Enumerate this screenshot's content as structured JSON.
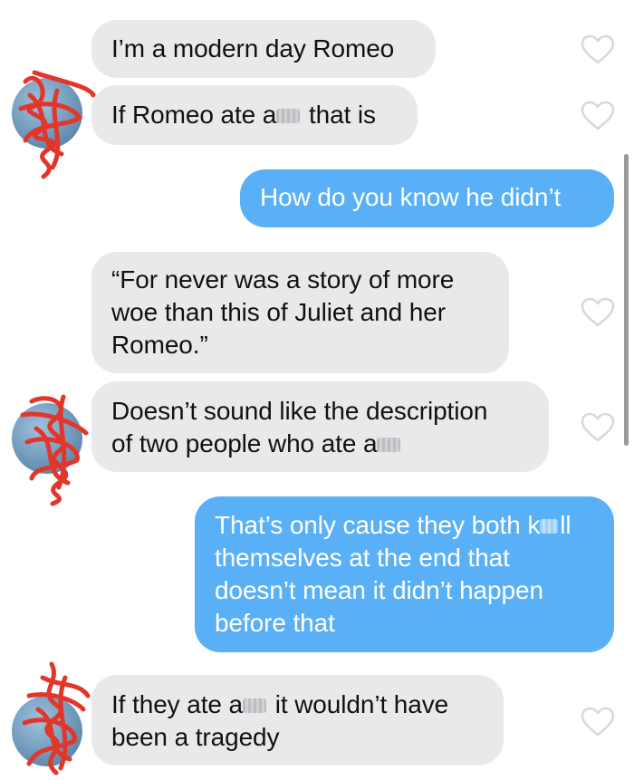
{
  "conversation": {
    "messages": [
      {
        "sender": "them",
        "text_lines": [
          "I’m a modern day Romeo"
        ]
      },
      {
        "sender": "them",
        "text_before": "If Romeo ate a",
        "text_after": " that is"
      },
      {
        "sender": "me",
        "text_lines": [
          "How do you know he didn’t"
        ]
      },
      {
        "sender": "them",
        "text_lines": [
          "“For never was a story of more",
          "woe than this of Juliet and her",
          "Romeo.”"
        ]
      },
      {
        "sender": "them",
        "line1": "Doesn’t sound like the description",
        "line2_before": "of two people who ate a"
      },
      {
        "sender": "me",
        "line1_before": "That’s only cause they both k",
        "line1_after": "ll",
        "lines_rest": [
          "themselves at the end that",
          "doesn’t mean it didn’t happen",
          "before that"
        ]
      },
      {
        "sender": "them",
        "line1_before": "If they ate a",
        "line1_after": " it wouldn’t have",
        "line2": "been a tragedy"
      }
    ]
  },
  "colors": {
    "incoming_bubble": "#e9e9eb",
    "outgoing_bubble": "#5ab0f7",
    "incoming_text": "#111111",
    "outgoing_text": "#ffffff",
    "heart_outline": "#d9d9dc",
    "scribble": "#e3362a"
  },
  "icons": {
    "like": "heart-outline-icon",
    "avatar": "profile-avatar"
  }
}
